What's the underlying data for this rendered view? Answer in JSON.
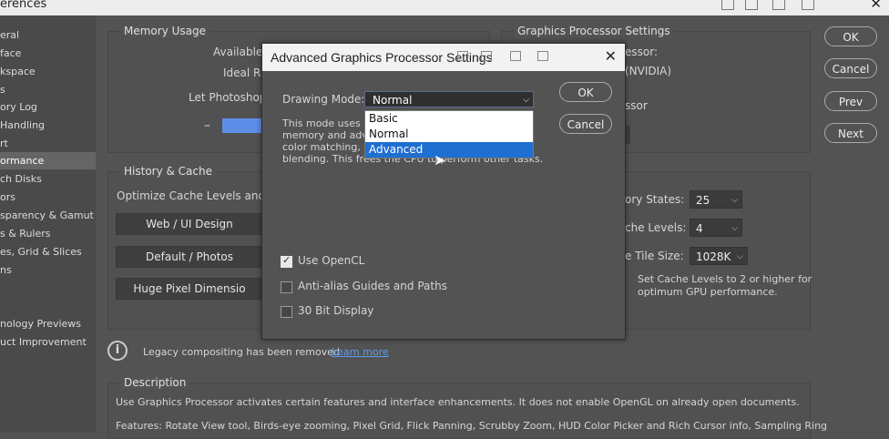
{
  "window": {
    "title": "erences"
  },
  "sidebar": {
    "items": [
      {
        "label": "eral"
      },
      {
        "label": "face"
      },
      {
        "label": "kspace"
      },
      {
        "label": "s"
      },
      {
        "label": "ory Log"
      },
      {
        "label": "Handling"
      },
      {
        "label": "rt"
      },
      {
        "label": "ormance",
        "selected": true
      },
      {
        "label": "ch Disks"
      },
      {
        "label": "ors"
      },
      {
        "label": "sparency & Gamut"
      },
      {
        "label": "s & Rulers"
      },
      {
        "label": "es, Grid & Slices"
      },
      {
        "label": "ns"
      },
      {
        "label": "nology Previews"
      },
      {
        "label": "uct Improvement"
      }
    ]
  },
  "memory": {
    "title": "Memory Usage",
    "available_label": "Available",
    "ideal_label": "Ideal Ra",
    "let_photoshop_label": "Let Photoshop",
    "slider_minus": "–"
  },
  "gpu_settings": {
    "title": "Graphics Processor Settings",
    "processor_label": "essor:",
    "nvidia": "(NVIDIA)",
    "use_label": "ssor"
  },
  "history": {
    "title": "History & Cache",
    "optimize_label": "Optimize Cache Levels and T",
    "buttons": [
      "Web / UI Design",
      "Default / Photos",
      "Huge Pixel Dimensio"
    ],
    "history_states_label": "ory States:",
    "history_states_value": "25",
    "cache_levels_label": "che Levels:",
    "cache_levels_value": "4",
    "tile_size_label": "e Tile Size:",
    "tile_size_value": "1028K",
    "hint_line1": "Set Cache Levels to 2 or higher for",
    "hint_line2": "optimum GPU performance."
  },
  "legacy": {
    "text": "Legacy compositing has been removed",
    "link": "Learn more"
  },
  "description": {
    "title": "Description",
    "line1": "Use Graphics Processor activates certain features and interface enhancements. It does not enable OpenGL on already open documents.",
    "line2": "Features: Rotate View tool, Birds-eye zooming, Pixel Grid, Flick Panning, Scrubby Zoom, HUD Color Picker and Rich Cursor info, Sampling Ring"
  },
  "right_buttons": {
    "ok": "OK",
    "cancel": "Cancel",
    "prev": "Prev",
    "next": "Next"
  },
  "dialog": {
    "title": "Advanced Graphics Processor Settings",
    "drawing_mode_label": "Drawing Mode:",
    "drawing_mode_value": "Normal",
    "options": [
      "Basic",
      "Normal",
      "Advanced"
    ],
    "highlighted_option": "Advanced",
    "desc_line1": "This mode uses a",
    "desc_line2": "memory and adva",
    "desc_line3": "color matching, to",
    "desc_line4": "blending.  This frees the CPU to perform other tasks.",
    "ok": "OK",
    "cancel": "Cancel",
    "use_opencl": "Use OpenCL",
    "use_opencl_checked": true,
    "antialias": "Anti-alias Guides and Paths",
    "antialias_checked": false,
    "bit30": "30 Bit Display",
    "bit30_checked": false
  }
}
